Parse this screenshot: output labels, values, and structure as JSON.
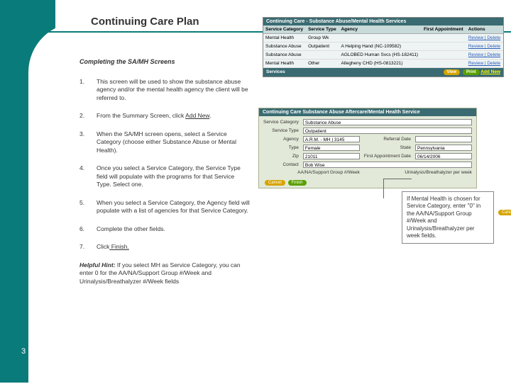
{
  "page": {
    "title": "Continuing Care Plan",
    "number": "3"
  },
  "section": {
    "subtitle": "Completing the SA/MH Screens"
  },
  "steps": [
    {
      "num": "1.",
      "text": "This screen will be used to show the substance abuse agency and/or the mental health agency the client will be referred to."
    },
    {
      "num": "2.",
      "pre": "From the Summary Screen, click ",
      "link": "Add New",
      "post": "."
    },
    {
      "num": "3.",
      "text": "When the SA/MH screen opens, select a Service Category (choose either Substance Abuse or Mental Health)."
    },
    {
      "num": "4.",
      "text": "Once you select a Service Category, the Service Type field will populate with the programs for that Service Type. Select one."
    },
    {
      "num": "5.",
      "text": "When you select a Service Category, the Agency field will populate with a list of agencies for that Service Category."
    },
    {
      "num": "6.",
      "text": "Complete the other fields."
    },
    {
      "num": "7.",
      "pre": "Click",
      "link": " Finish.",
      "post": ""
    }
  ],
  "hint": {
    "label": "Helpful Hint:",
    "text": "  If you select MH as Service Category, you can enter 0 for the AA/NA/Support Group #/Week and Urinalysis/Breathalyzer #/Week fields"
  },
  "shot1": {
    "title": "Continuing Care - Substance Abuse/Mental Health Services",
    "headers": [
      "Service Category",
      "Service Type",
      "Agency",
      "First Appointment",
      "Actions"
    ],
    "rows": [
      [
        "Mental Health",
        "Group Wk",
        "",
        "",
        "Review | Delete"
      ],
      [
        "Substance Abuse",
        "Outpatient",
        "A Helping Hand (NC-109582)",
        "",
        "Review | Delete"
      ],
      [
        "Substance Abuse",
        "",
        "AGLOBED Human Svcs (HS-182411)",
        "",
        "Review | Delete"
      ],
      [
        "Mental Health",
        "Other",
        "Allegheny CHD (HS-0813221)",
        "",
        "Review | Delete"
      ]
    ],
    "servicesLabel": "Services",
    "pills": [
      "View",
      "Print"
    ],
    "addNew": "Add New"
  },
  "shot2": {
    "title": "Continuing Care   Substance Abuse Aftercare/Mental Health Service",
    "fields": {
      "serviceCategory": {
        "label": "Service Category",
        "value": "Substance Abuse"
      },
      "serviceType": {
        "label": "Service Type",
        "value": "Outpatient"
      },
      "agency": {
        "label": "Agency",
        "value": "A.R.M. - MH | 3145"
      },
      "referralDate": {
        "label": "Referral Date",
        "value": ""
      },
      "type": {
        "label": "Type",
        "value": "Female"
      },
      "state": {
        "label": "State",
        "value": "Pennsylvania"
      },
      "zip": {
        "label": "Zip",
        "value": "21011"
      },
      "firstAppt": {
        "label": "First Appointment Date",
        "value": "06/14/2006"
      },
      "contact": {
        "label": "Contact",
        "value": "Bob Wise"
      },
      "supportGroup": {
        "label": "AA/NA/Support Group #/Week",
        "value": ""
      },
      "urinalysis": {
        "label": "Urinalysis/Breathalyzer per week",
        "value": ""
      }
    },
    "buttons": {
      "cancel": "Cancel",
      "finish": "Finish"
    }
  },
  "callout": {
    "text": "If Mental Health is chosen for Service Category, enter \"0\" in the AA/NA/Support Group #/Week and Urinalysis/Breathalyzer per week fields."
  }
}
